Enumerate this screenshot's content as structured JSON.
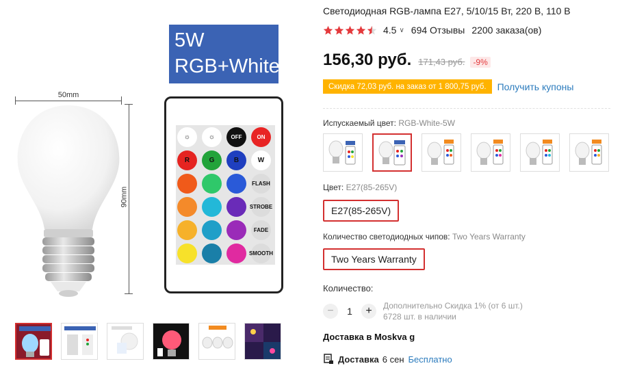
{
  "product": {
    "title": "Светодиодная RGB-лампа E27, 5/10/15 Вт, 220 В, 110 В",
    "rating": "4.5",
    "reviews": "694 Отзывы",
    "orders": "2200 заказа(ов)",
    "price": "156,30 руб.",
    "old_price": "171,43 руб.",
    "discount": "-9%",
    "coupon_text": "Скидка 72,03 руб. на заказ от 1 800,75 руб.",
    "coupon_link": "Получить купоны"
  },
  "image": {
    "badge_line1": "5W",
    "badge_line2": "RGB+White",
    "dim_width": "50mm",
    "dim_height": "90mm",
    "remote_buttons": [
      "OFF",
      "ON",
      "R",
      "G",
      "B",
      "W",
      "FLASH",
      "STROBE",
      "FADE",
      "SMOOTH"
    ]
  },
  "options": {
    "color_label": "Испускаемый цвет:",
    "color_value": "RGB-White-5W",
    "base_label": "Цвет:",
    "base_value": "E27(85-265V)",
    "base_selected": "E27(85-265V)",
    "chips_label": "Количество светодиодных чипов:",
    "chips_value": "Two Years Warranty",
    "chips_selected": "Two Years Warranty"
  },
  "quantity": {
    "label": "Количество:",
    "minus": "−",
    "value": "1",
    "plus": "+",
    "extra_discount": "Дополнительно Скидка 1% (от 6 шт.)",
    "stock": "6728 шт. в наличии"
  },
  "delivery": {
    "heading": "Доставка в Moskva g",
    "label": "Доставка",
    "date": "6 сен",
    "price": "Бесплатно"
  },
  "colors": {
    "accent_red": "#d32f2f",
    "star": "#e4393c",
    "link": "#2b7bbd",
    "coupon": "#ffb300",
    "badge_blue": "#3b63b4"
  }
}
